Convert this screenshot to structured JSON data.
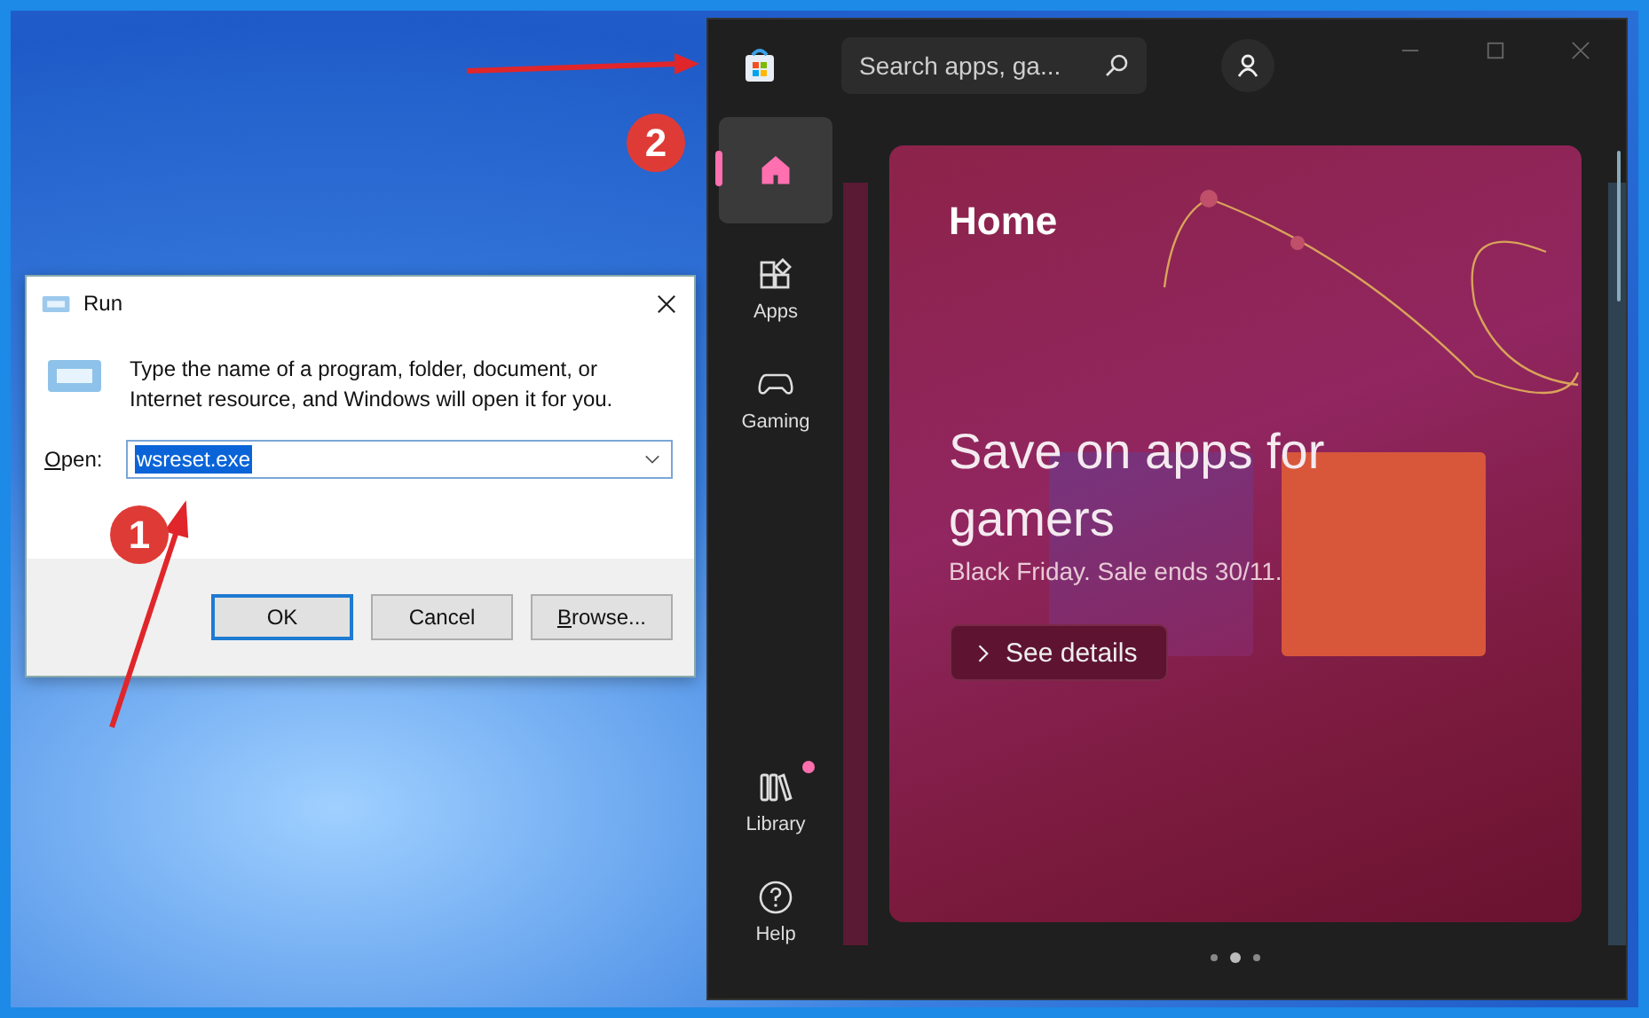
{
  "run_dialog": {
    "title": "Run",
    "prompt": "Type the name of a program, folder, document, or Internet resource, and Windows will open it for you.",
    "open_label": "Open:",
    "open_value": "wsreset.exe",
    "buttons": [
      {
        "label": "OK",
        "default": true
      },
      {
        "label": "Cancel",
        "default": false
      },
      {
        "label": "Browse...",
        "default": false
      }
    ]
  },
  "store": {
    "search": {
      "placeholder": "Search apps, ga..."
    },
    "nav": [
      {
        "kind": "home",
        "selected": true,
        "notification": false
      },
      {
        "kind": "apps",
        "label": "Apps",
        "selected": false,
        "notification": false
      },
      {
        "kind": "gaming",
        "label": "Gaming",
        "selected": false,
        "notification": false
      },
      {
        "kind": "library",
        "label": "Library",
        "selected": false,
        "notification": true
      },
      {
        "kind": "help",
        "label": "Help",
        "selected": false,
        "notification": false
      }
    ],
    "hero": {
      "title": "Home",
      "headline": "Save on apps for gamers",
      "subtitle": "Black Friday. Sale ends 30/11.",
      "button": "See details"
    },
    "carousel_dots": [
      {
        "selected": false
      },
      {
        "selected": true
      },
      {
        "selected": false
      }
    ]
  },
  "annotations": [
    {
      "number": "1"
    },
    {
      "number": "2"
    }
  ]
}
